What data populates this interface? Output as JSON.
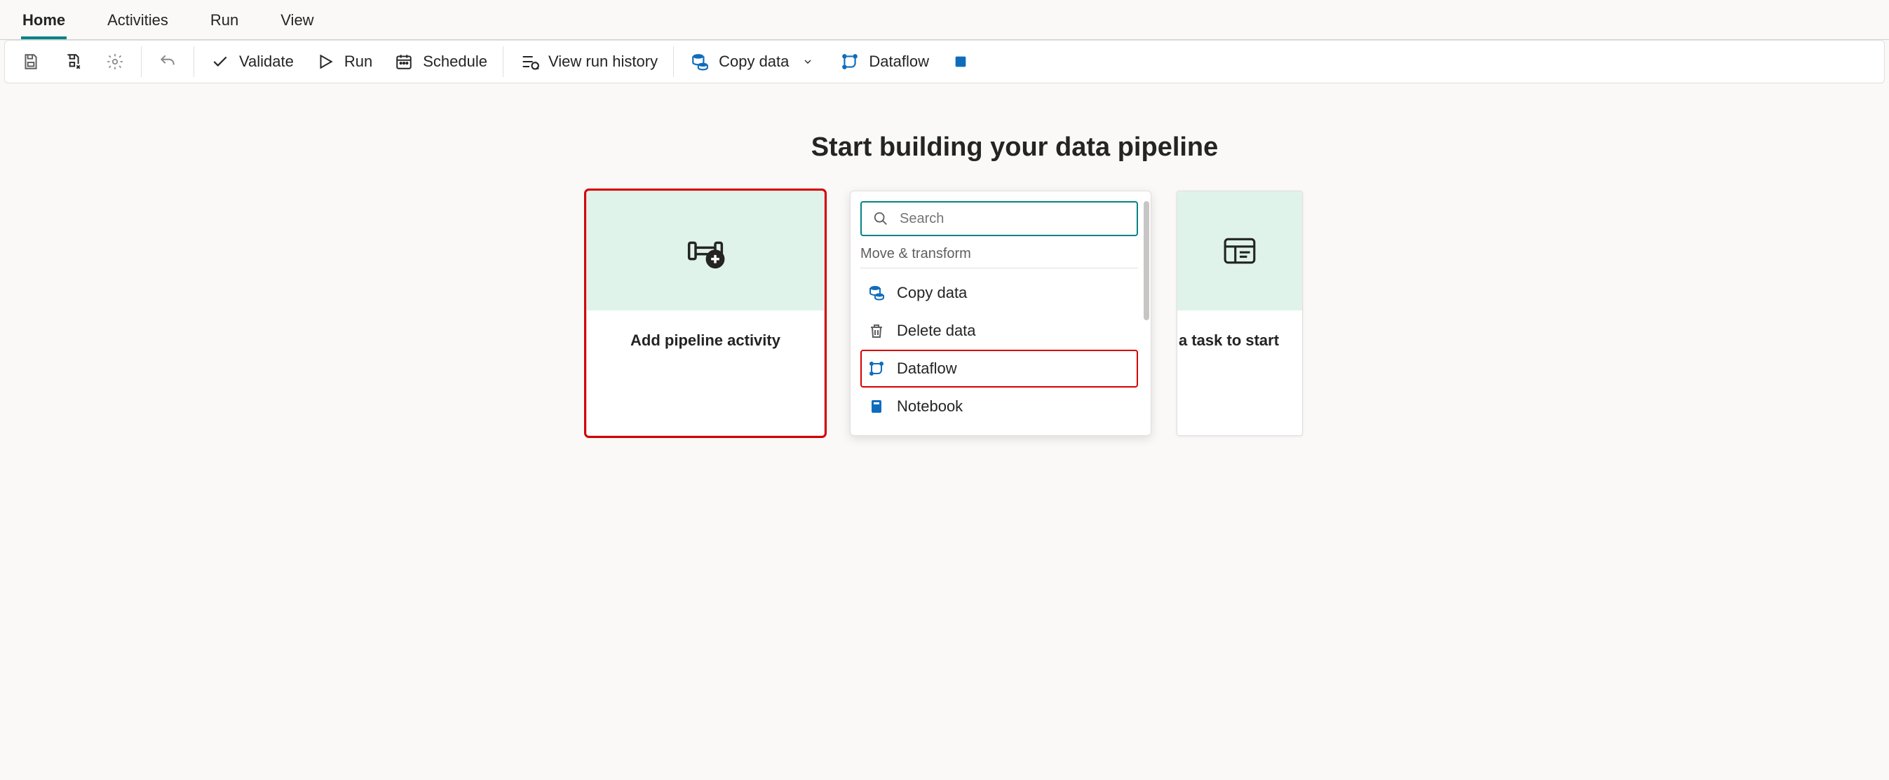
{
  "tabs": {
    "home": "Home",
    "activities": "Activities",
    "run": "Run",
    "view": "View"
  },
  "toolbar": {
    "validate": "Validate",
    "run": "Run",
    "schedule": "Schedule",
    "view_run_history": "View run history",
    "copy_data": "Copy data",
    "dataflow": "Dataflow"
  },
  "headline": "Start building your data pipeline",
  "card_add_activity": "Add pipeline activity",
  "right_card_label": "a task to start",
  "search_placeholder": "Search",
  "popup": {
    "group_label": "Move & transform",
    "items": {
      "copy_data": "Copy data",
      "delete_data": "Delete data",
      "dataflow": "Dataflow",
      "notebook": "Notebook"
    }
  }
}
